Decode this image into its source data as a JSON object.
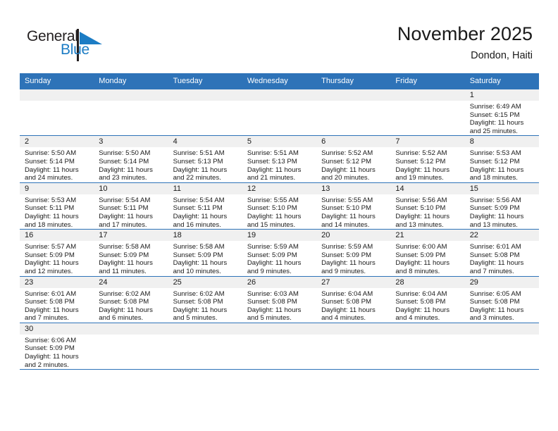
{
  "brand": {
    "name_part1": "General",
    "name_part2": "Blue",
    "flag_icon": "blue-triangle-flag-icon",
    "color_primary": "#1c7cc4",
    "color_dark": "#231f20"
  },
  "header": {
    "month_title": "November 2025",
    "location": "Dondon, Haiti",
    "header_bg": "#2e73b8"
  },
  "weekdays": [
    "Sunday",
    "Monday",
    "Tuesday",
    "Wednesday",
    "Thursday",
    "Friday",
    "Saturday"
  ],
  "weeks": [
    [
      {
        "day": ""
      },
      {
        "day": ""
      },
      {
        "day": ""
      },
      {
        "day": ""
      },
      {
        "day": ""
      },
      {
        "day": ""
      },
      {
        "day": "1",
        "sunrise": "Sunrise: 6:49 AM",
        "sunset": "Sunset: 6:15 PM",
        "daylight_line1": "Daylight: 11 hours",
        "daylight_line2": "and 25 minutes."
      }
    ],
    [
      {
        "day": "2",
        "sunrise": "Sunrise: 5:50 AM",
        "sunset": "Sunset: 5:14 PM",
        "daylight_line1": "Daylight: 11 hours",
        "daylight_line2": "and 24 minutes."
      },
      {
        "day": "3",
        "sunrise": "Sunrise: 5:50 AM",
        "sunset": "Sunset: 5:14 PM",
        "daylight_line1": "Daylight: 11 hours",
        "daylight_line2": "and 23 minutes."
      },
      {
        "day": "4",
        "sunrise": "Sunrise: 5:51 AM",
        "sunset": "Sunset: 5:13 PM",
        "daylight_line1": "Daylight: 11 hours",
        "daylight_line2": "and 22 minutes."
      },
      {
        "day": "5",
        "sunrise": "Sunrise: 5:51 AM",
        "sunset": "Sunset: 5:13 PM",
        "daylight_line1": "Daylight: 11 hours",
        "daylight_line2": "and 21 minutes."
      },
      {
        "day": "6",
        "sunrise": "Sunrise: 5:52 AM",
        "sunset": "Sunset: 5:12 PM",
        "daylight_line1": "Daylight: 11 hours",
        "daylight_line2": "and 20 minutes."
      },
      {
        "day": "7",
        "sunrise": "Sunrise: 5:52 AM",
        "sunset": "Sunset: 5:12 PM",
        "daylight_line1": "Daylight: 11 hours",
        "daylight_line2": "and 19 minutes."
      },
      {
        "day": "8",
        "sunrise": "Sunrise: 5:53 AM",
        "sunset": "Sunset: 5:12 PM",
        "daylight_line1": "Daylight: 11 hours",
        "daylight_line2": "and 18 minutes."
      }
    ],
    [
      {
        "day": "9",
        "sunrise": "Sunrise: 5:53 AM",
        "sunset": "Sunset: 5:11 PM",
        "daylight_line1": "Daylight: 11 hours",
        "daylight_line2": "and 18 minutes."
      },
      {
        "day": "10",
        "sunrise": "Sunrise: 5:54 AM",
        "sunset": "Sunset: 5:11 PM",
        "daylight_line1": "Daylight: 11 hours",
        "daylight_line2": "and 17 minutes."
      },
      {
        "day": "11",
        "sunrise": "Sunrise: 5:54 AM",
        "sunset": "Sunset: 5:11 PM",
        "daylight_line1": "Daylight: 11 hours",
        "daylight_line2": "and 16 minutes."
      },
      {
        "day": "12",
        "sunrise": "Sunrise: 5:55 AM",
        "sunset": "Sunset: 5:10 PM",
        "daylight_line1": "Daylight: 11 hours",
        "daylight_line2": "and 15 minutes."
      },
      {
        "day": "13",
        "sunrise": "Sunrise: 5:55 AM",
        "sunset": "Sunset: 5:10 PM",
        "daylight_line1": "Daylight: 11 hours",
        "daylight_line2": "and 14 minutes."
      },
      {
        "day": "14",
        "sunrise": "Sunrise: 5:56 AM",
        "sunset": "Sunset: 5:10 PM",
        "daylight_line1": "Daylight: 11 hours",
        "daylight_line2": "and 13 minutes."
      },
      {
        "day": "15",
        "sunrise": "Sunrise: 5:56 AM",
        "sunset": "Sunset: 5:09 PM",
        "daylight_line1": "Daylight: 11 hours",
        "daylight_line2": "and 13 minutes."
      }
    ],
    [
      {
        "day": "16",
        "sunrise": "Sunrise: 5:57 AM",
        "sunset": "Sunset: 5:09 PM",
        "daylight_line1": "Daylight: 11 hours",
        "daylight_line2": "and 12 minutes."
      },
      {
        "day": "17",
        "sunrise": "Sunrise: 5:58 AM",
        "sunset": "Sunset: 5:09 PM",
        "daylight_line1": "Daylight: 11 hours",
        "daylight_line2": "and 11 minutes."
      },
      {
        "day": "18",
        "sunrise": "Sunrise: 5:58 AM",
        "sunset": "Sunset: 5:09 PM",
        "daylight_line1": "Daylight: 11 hours",
        "daylight_line2": "and 10 minutes."
      },
      {
        "day": "19",
        "sunrise": "Sunrise: 5:59 AM",
        "sunset": "Sunset: 5:09 PM",
        "daylight_line1": "Daylight: 11 hours",
        "daylight_line2": "and 9 minutes."
      },
      {
        "day": "20",
        "sunrise": "Sunrise: 5:59 AM",
        "sunset": "Sunset: 5:09 PM",
        "daylight_line1": "Daylight: 11 hours",
        "daylight_line2": "and 9 minutes."
      },
      {
        "day": "21",
        "sunrise": "Sunrise: 6:00 AM",
        "sunset": "Sunset: 5:09 PM",
        "daylight_line1": "Daylight: 11 hours",
        "daylight_line2": "and 8 minutes."
      },
      {
        "day": "22",
        "sunrise": "Sunrise: 6:01 AM",
        "sunset": "Sunset: 5:08 PM",
        "daylight_line1": "Daylight: 11 hours",
        "daylight_line2": "and 7 minutes."
      }
    ],
    [
      {
        "day": "23",
        "sunrise": "Sunrise: 6:01 AM",
        "sunset": "Sunset: 5:08 PM",
        "daylight_line1": "Daylight: 11 hours",
        "daylight_line2": "and 7 minutes."
      },
      {
        "day": "24",
        "sunrise": "Sunrise: 6:02 AM",
        "sunset": "Sunset: 5:08 PM",
        "daylight_line1": "Daylight: 11 hours",
        "daylight_line2": "and 6 minutes."
      },
      {
        "day": "25",
        "sunrise": "Sunrise: 6:02 AM",
        "sunset": "Sunset: 5:08 PM",
        "daylight_line1": "Daylight: 11 hours",
        "daylight_line2": "and 5 minutes."
      },
      {
        "day": "26",
        "sunrise": "Sunrise: 6:03 AM",
        "sunset": "Sunset: 5:08 PM",
        "daylight_line1": "Daylight: 11 hours",
        "daylight_line2": "and 5 minutes."
      },
      {
        "day": "27",
        "sunrise": "Sunrise: 6:04 AM",
        "sunset": "Sunset: 5:08 PM",
        "daylight_line1": "Daylight: 11 hours",
        "daylight_line2": "and 4 minutes."
      },
      {
        "day": "28",
        "sunrise": "Sunrise: 6:04 AM",
        "sunset": "Sunset: 5:08 PM",
        "daylight_line1": "Daylight: 11 hours",
        "daylight_line2": "and 4 minutes."
      },
      {
        "day": "29",
        "sunrise": "Sunrise: 6:05 AM",
        "sunset": "Sunset: 5:08 PM",
        "daylight_line1": "Daylight: 11 hours",
        "daylight_line2": "and 3 minutes."
      }
    ],
    [
      {
        "day": "30",
        "sunrise": "Sunrise: 6:06 AM",
        "sunset": "Sunset: 5:09 PM",
        "daylight_line1": "Daylight: 11 hours",
        "daylight_line2": "and 2 minutes."
      },
      {
        "day": ""
      },
      {
        "day": ""
      },
      {
        "day": ""
      },
      {
        "day": ""
      },
      {
        "day": ""
      },
      {
        "day": ""
      }
    ]
  ]
}
